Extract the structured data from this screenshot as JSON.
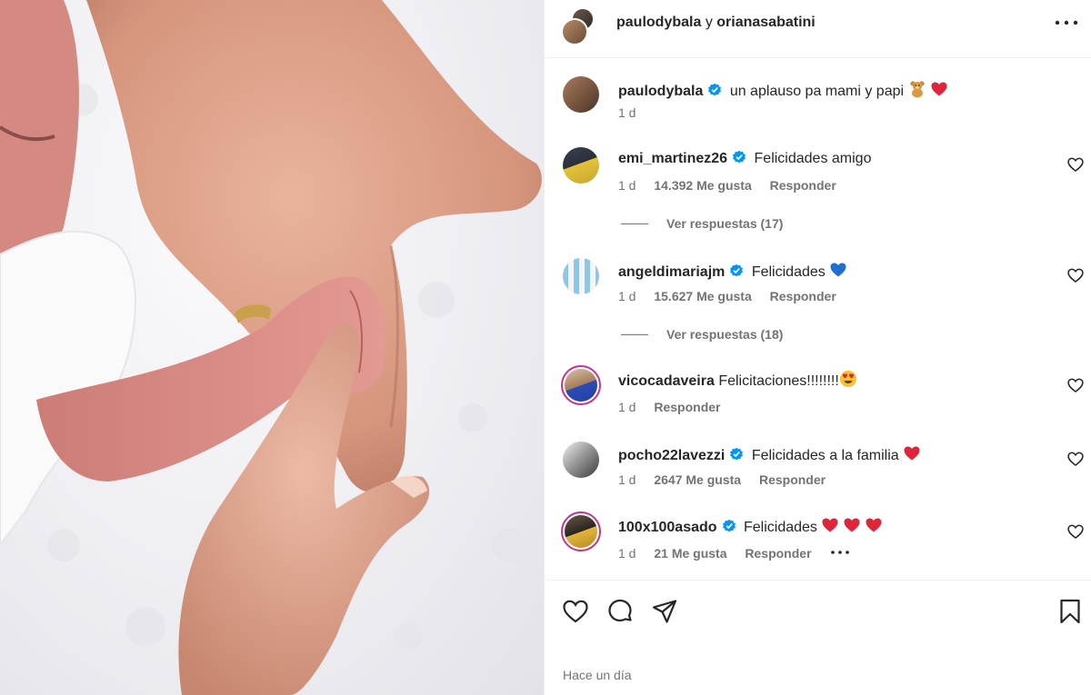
{
  "header": {
    "user1": "paulodybala",
    "connector": "y",
    "user2": "orianasabatini",
    "more_icon": "more-horizontal-icon"
  },
  "caption": {
    "username": "paulodybala",
    "text": "un aplauso pa mami y papi",
    "emojis": [
      "teddy-bear",
      "heart"
    ],
    "time": "1 d"
  },
  "comments": [
    {
      "username": "emi_martinez26",
      "verified": true,
      "text": "Felicidades amigo",
      "time": "1 d",
      "likes": "14.392 Me gusta",
      "reply": "Responder",
      "view_replies": "Ver respuestas (17)"
    },
    {
      "username": "angeldimariajm",
      "verified": true,
      "text": "Felicidades",
      "time": "1 d",
      "likes": "15.627 Me gusta",
      "reply": "Responder",
      "view_replies": "Ver respuestas (18)"
    },
    {
      "username": "vicocadaveira",
      "verified": false,
      "text": "Felicitaciones!!!!!!!!",
      "time": "1 d",
      "reply": "Responder"
    },
    {
      "username": "pocho22lavezzi",
      "verified": true,
      "text": "Felicidades a la familia",
      "time": "1 d",
      "likes": "2647 Me gusta",
      "reply": "Responder"
    },
    {
      "username": "100x100asado",
      "verified": true,
      "text": "Felicidades",
      "time": "1 d",
      "likes": "21 Me gusta",
      "reply": "Responder"
    }
  ],
  "footer": {
    "timestamp": "Hace un día",
    "icons": [
      "heart-icon",
      "comment-icon",
      "share-icon",
      "bookmark-icon"
    ]
  },
  "colors": {
    "verified": "#0095f6",
    "heart_red": "#e0243a",
    "blue_heart": "#1f6fd1",
    "secondary_text": "#737373"
  }
}
